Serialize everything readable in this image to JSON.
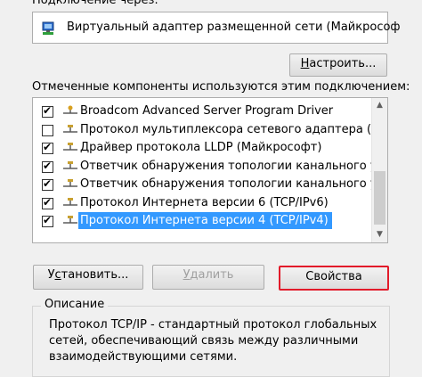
{
  "header": {
    "connect_via_label": "Подключение через:",
    "adapter_name": "Виртуальный адаптер размещенной сети (Майкрософ"
  },
  "buttons": {
    "configure_prefix": "",
    "configure_accel": "Н",
    "configure_rest": "астроить...",
    "install_prefix": "У",
    "install_accel": "с",
    "install_rest": "тановить...",
    "remove_prefix": "",
    "remove_accel": "У",
    "remove_rest": "далить",
    "properties_label": "Свойства"
  },
  "components": {
    "label": "Отмеченные компоненты используются этим подключением:",
    "items": [
      {
        "label": "Broadcom Advanced Server Program Driver",
        "checked": true,
        "icon": "network-service-icon"
      },
      {
        "label": "Протокол мультиплексора сетевого адаптера (Ма",
        "checked": false,
        "icon": "network-protocol-icon"
      },
      {
        "label": "Драйвер протокола LLDP (Майкрософт)",
        "checked": true,
        "icon": "network-protocol-icon"
      },
      {
        "label": "Ответчик обнаружения топологии канального уров",
        "checked": true,
        "icon": "network-protocol-icon"
      },
      {
        "label": "Ответчик обнаружения топологии канального уров",
        "checked": true,
        "icon": "network-protocol-icon"
      },
      {
        "label": "Протокол Интернета версии 6 (TCP/IPv6)",
        "checked": true,
        "icon": "network-protocol-icon"
      },
      {
        "label": "Протокол Интернета версии 4 (TCP/IPv4)",
        "checked": true,
        "icon": "network-protocol-icon",
        "selected": true
      }
    ]
  },
  "description": {
    "legend": "Описание",
    "text": "Протокол TCP/IP - стандартный протокол глобальных\nсетей, обеспечивающий связь между различными\nвзаимодействующими сетями."
  },
  "colors": {
    "selection": "#3399ff",
    "highlight_border": "#e21b2a"
  }
}
